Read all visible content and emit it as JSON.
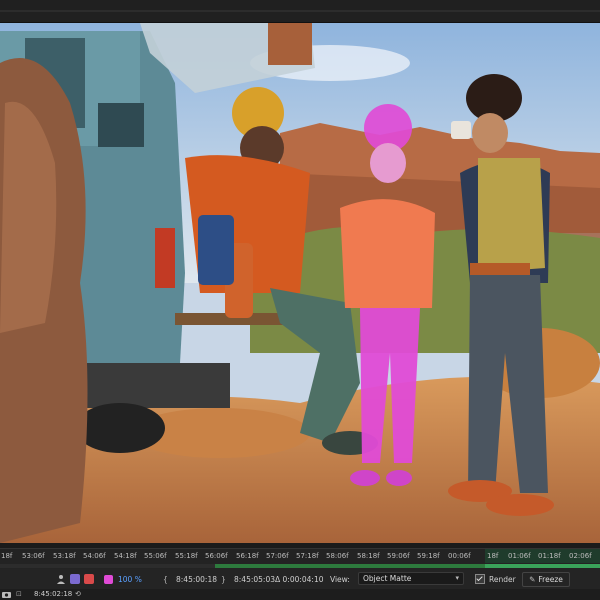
{
  "ruler": {
    "ticks": [
      "18f",
      "53:06f",
      "53:18f",
      "54:06f",
      "54:18f",
      "55:06f",
      "55:18f",
      "56:06f",
      "56:18f",
      "57:06f",
      "57:18f",
      "58:06f",
      "58:18f",
      "59:06f",
      "59:18f",
      "00:06f",
      "18f",
      "01:06f",
      "01:18f",
      "02:06f"
    ]
  },
  "controls": {
    "zoom": "100 %",
    "time_current": "8:45:00:18",
    "time_end": "8:45:05:03",
    "duration": "Δ 0:00:04:10",
    "view_label": "View:",
    "view_value": "Object Matte",
    "render_label": "Render",
    "freeze_label": "Freeze"
  },
  "status": {
    "timecode": "8:45:02:18"
  },
  "colors": {
    "matte": "#e04bd6",
    "accent_green": "#3aa35a"
  },
  "icons": [
    "camera-icon",
    "snapshot-icon",
    "left-bracket-icon",
    "right-bracket-icon",
    "render-checkbox",
    "freeze-icon"
  ]
}
